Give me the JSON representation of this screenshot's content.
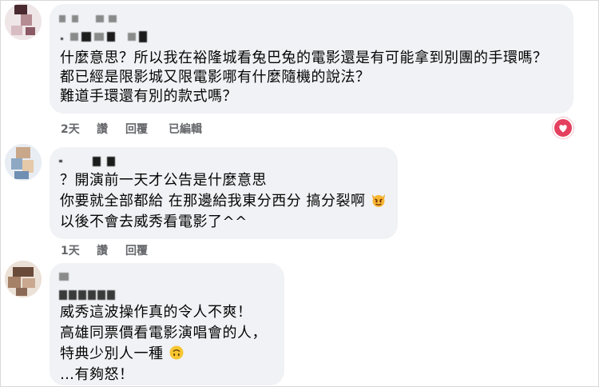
{
  "comments": [
    {
      "lines": [
        "什麼意思？所以我在裕隆城看兔巴兔的電影還是有可能拿到別團的手環嗎？",
        "都已經是限影城又限電影哪有什麼隨機的說法？",
        "難道手環還有別的款式嗎？"
      ],
      "time": "2天",
      "like": "讚",
      "reply": "回覆",
      "edited": "已編輯",
      "reaction_icon": "heart-reaction-icon",
      "reaction_color": "#e4405f"
    },
    {
      "lines": [
        "？開演前一天才公告是什麼意思",
        "你要就全部都給 在那邊給我東分西分 搞分裂啊",
        "以後不會去威秀看電影了^^"
      ],
      "emoji_icon": "angry-devil-cat-emoji-icon",
      "time": "1天",
      "like": "讚",
      "reply": "回覆"
    },
    {
      "lines": [
        "威秀這波操作真的令人不爽！",
        "高雄同票價看電影演唱會的人，",
        "特典少別人一種",
        "…有夠怒！"
      ],
      "emoji_icon": "upside-down-face-emoji-icon"
    }
  ],
  "colors": {
    "bubble": "#f0f2f5",
    "action_text": "#65676b",
    "text": "#050505"
  }
}
